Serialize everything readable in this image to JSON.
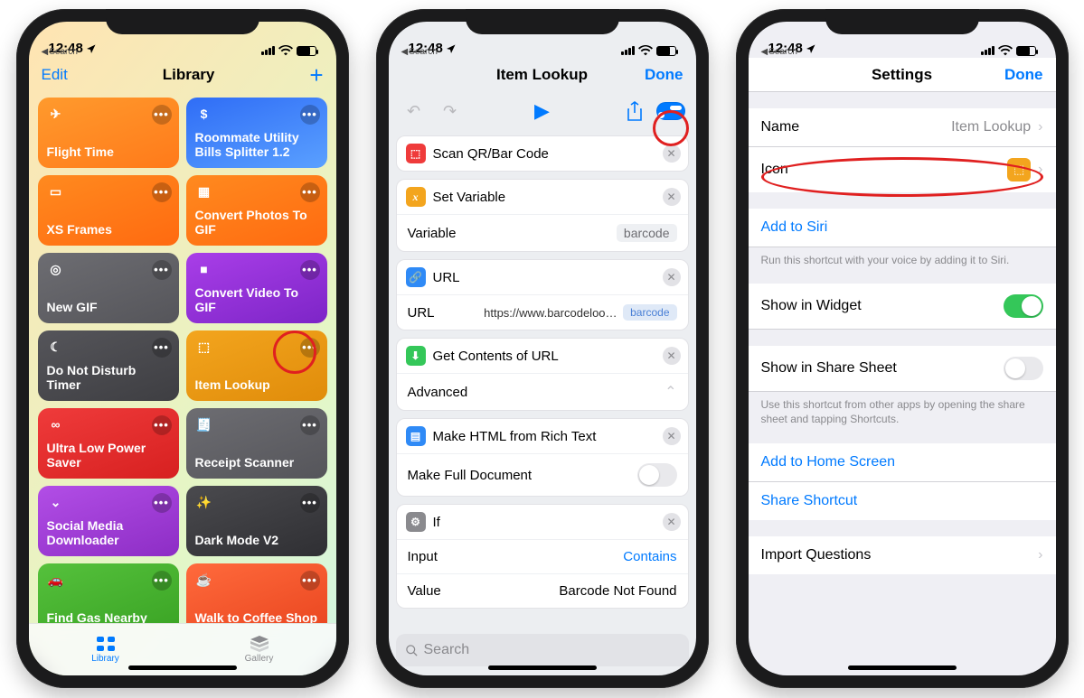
{
  "status": {
    "time": "12:48",
    "back_crumb": "Search"
  },
  "phone1": {
    "nav": {
      "edit": "Edit",
      "title": "Library",
      "add": "+"
    },
    "tiles": [
      {
        "label": "Flight Time",
        "icon": "✈",
        "color1": "#ff9a2d",
        "color2": "#ff7a1a"
      },
      {
        "label": "Roommate Utility Bills Splitter 1.2",
        "icon": "$",
        "color1": "#2f6df6",
        "color2": "#5aa0ff"
      },
      {
        "label": "XS Frames",
        "icon": "▭",
        "color1": "#ff8a1f",
        "color2": "#ff6a10"
      },
      {
        "label": "Convert Photos To GIF",
        "icon": "▦",
        "color1": "#ff8a1f",
        "color2": "#ff6a10"
      },
      {
        "label": "New GIF",
        "icon": "◎",
        "color1": "#6d6d72",
        "color2": "#55555a"
      },
      {
        "label": "Convert Video To GIF",
        "icon": "■",
        "color1": "#a93ee8",
        "color2": "#7d25c7"
      },
      {
        "label": "Do Not Disturb Timer",
        "icon": "☾",
        "color1": "#55555a",
        "color2": "#3e3e42"
      },
      {
        "label": "Item Lookup",
        "icon": "⬚",
        "color1": "#f3a51e",
        "color2": "#e08c0a"
      },
      {
        "label": "Ultra Low Power Saver",
        "icon": "∞",
        "color1": "#ef3b3b",
        "color2": "#d72020"
      },
      {
        "label": "Receipt Scanner",
        "icon": "🧾",
        "color1": "#6d6d72",
        "color2": "#55555a"
      },
      {
        "label": "Social Media Downloader",
        "icon": "⌄",
        "color1": "#b24ee6",
        "color2": "#8d2dc5"
      },
      {
        "label": "Dark Mode V2",
        "icon": "✨",
        "color1": "#4a4a4e",
        "color2": "#2f2f33"
      },
      {
        "label": "Find Gas Nearby",
        "icon": "🚗",
        "color1": "#55c13c",
        "color2": "#3aa324"
      },
      {
        "label": "Walk to Coffee Shop",
        "icon": "☕",
        "color1": "#ff6a3c",
        "color2": "#e9451f"
      }
    ],
    "tabs": {
      "library": "Library",
      "gallery": "Gallery"
    }
  },
  "phone2": {
    "title": "Item Lookup",
    "done": "Done",
    "actions": {
      "scan": {
        "label": "Scan QR/Bar Code"
      },
      "setvar": {
        "label": "Set Variable",
        "param_name": "Variable",
        "param_value": "barcode"
      },
      "url": {
        "label": "URL",
        "param_name": "URL",
        "param_value": "https://www.barcodelookup.com/",
        "token": "barcode"
      },
      "getcontents": {
        "label": "Get Contents of URL",
        "advanced": "Advanced"
      },
      "makehtml": {
        "label": "Make HTML from Rich Text",
        "param_name": "Make Full Document"
      },
      "if": {
        "label": "If",
        "input_name": "Input",
        "input_value": "Contains",
        "value_name": "Value",
        "value_value": "Barcode Not Found"
      }
    },
    "search_placeholder": "Search"
  },
  "phone3": {
    "title": "Settings",
    "done": "Done",
    "rows": {
      "name_label": "Name",
      "name_value": "Item Lookup",
      "icon_label": "Icon",
      "add_siri": "Add to Siri",
      "siri_note": "Run this shortcut with your voice by adding it to Siri.",
      "widget": "Show in Widget",
      "sharesheet": "Show in Share Sheet",
      "sharesheet_note": "Use this shortcut from other apps by opening the share sheet and tapping Shortcuts.",
      "homescreen": "Add to Home Screen",
      "share": "Share Shortcut",
      "import": "Import Questions"
    }
  }
}
